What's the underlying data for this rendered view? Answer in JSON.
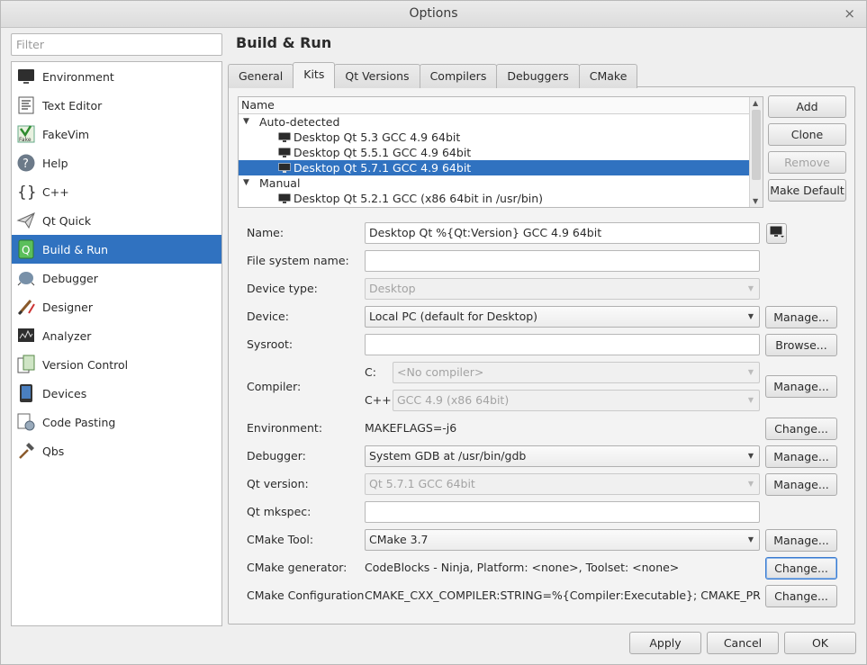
{
  "window": {
    "title": "Options",
    "close": "×"
  },
  "filter": {
    "placeholder": "Filter",
    "value": ""
  },
  "categories": [
    {
      "label": "Environment",
      "icon": "monitor-icon"
    },
    {
      "label": "Text Editor",
      "icon": "text-editor-icon"
    },
    {
      "label": "FakeVim",
      "icon": "fakevim-icon"
    },
    {
      "label": "Help",
      "icon": "help-icon"
    },
    {
      "label": "C++",
      "icon": "braces-icon"
    },
    {
      "label": "Qt Quick",
      "icon": "paper-plane-icon"
    },
    {
      "label": "Build & Run",
      "icon": "build-run-icon",
      "selected": true
    },
    {
      "label": "Debugger",
      "icon": "bug-icon"
    },
    {
      "label": "Designer",
      "icon": "brush-icon"
    },
    {
      "label": "Analyzer",
      "icon": "chart-icon"
    },
    {
      "label": "Version Control",
      "icon": "vcs-icon"
    },
    {
      "label": "Devices",
      "icon": "tablet-icon"
    },
    {
      "label": "Code Pasting",
      "icon": "paste-icon"
    },
    {
      "label": "Qbs",
      "icon": "hammer-icon"
    }
  ],
  "page": {
    "title": "Build & Run",
    "tabs": [
      "General",
      "Kits",
      "Qt Versions",
      "Compilers",
      "Debuggers",
      "CMake"
    ],
    "active_tab": "Kits"
  },
  "kits": {
    "header": "Name",
    "groups": [
      {
        "label": "Auto-detected",
        "items": [
          {
            "label": "Desktop Qt 5.3 GCC 4.9 64bit"
          },
          {
            "label": "Desktop Qt 5.5.1 GCC 4.9 64bit"
          },
          {
            "label": "Desktop Qt 5.7.1 GCC 4.9 64bit",
            "selected": true
          }
        ]
      },
      {
        "label": "Manual",
        "items": [
          {
            "label": "Desktop Qt 5.2.1 GCC (x86 64bit in /usr/bin)"
          }
        ]
      }
    ],
    "buttons": {
      "add": "Add",
      "clone": "Clone",
      "remove": "Remove",
      "make_default": "Make Default"
    }
  },
  "form": {
    "name_label": "Name:",
    "name_value": "Desktop Qt %{Qt:Version} GCC 4.9 64bit",
    "fsname_label": "File system name:",
    "fsname_value": "",
    "devtype_label": "Device type:",
    "devtype_value": "Desktop",
    "device_label": "Device:",
    "device_value": "Local PC (default for Desktop)",
    "sysroot_label": "Sysroot:",
    "sysroot_value": "",
    "compiler_label": "Compiler:",
    "compiler_c_label": "C:",
    "compiler_c_value": "<No compiler>",
    "compiler_cxx_label": "C++:",
    "compiler_cxx_value": "GCC 4.9 (x86 64bit)",
    "env_label": "Environment:",
    "env_value": "MAKEFLAGS=-j6",
    "debugger_label": "Debugger:",
    "debugger_value": "System GDB at /usr/bin/gdb",
    "qtversion_label": "Qt version:",
    "qtversion_value": "Qt 5.7.1 GCC 64bit",
    "mkspec_label": "Qt mkspec:",
    "mkspec_value": "",
    "cmaketool_label": "CMake Tool:",
    "cmaketool_value": "CMake 3.7",
    "cmakegen_label": "CMake generator:",
    "cmakegen_value": "CodeBlocks - Ninja, Platform: <none>, Toolset: <none>",
    "cmakeconf_label": "CMake Configuration",
    "cmakeconf_value": "CMAKE_CXX_COMPILER:STRING=%{Compiler:Executable}; CMAKE_PREFI...",
    "manage": "Manage...",
    "browse": "Browse...",
    "change": "Change..."
  },
  "footer": {
    "apply": "Apply",
    "cancel": "Cancel",
    "ok": "OK"
  },
  "colors": {
    "selection": "#3072c0",
    "focus_border": "#3a7bd0"
  }
}
